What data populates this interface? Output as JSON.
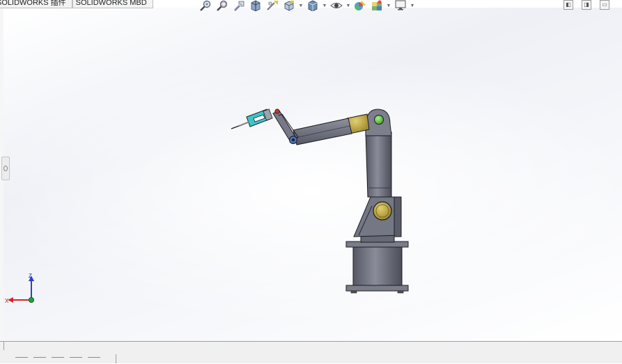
{
  "tabs": [
    {
      "label": "SOLIDWORKS 插件"
    },
    {
      "label": "SOLIDWORKS MBD"
    }
  ],
  "toolbar": {
    "icons": [
      "zoom-to-fit-icon",
      "zoom-to-area-icon",
      "previous-view-icon",
      "section-view-icon",
      "dynamic-annotation-icon",
      "view-orientation-icon",
      "display-style-icon",
      "hide-show-items-icon",
      "edit-appearance-icon",
      "apply-scene-icon",
      "view-settings-icon"
    ]
  },
  "triad": {
    "x_label": "X",
    "z_label": "Z"
  },
  "colors": {
    "arm_body": "#6c6f7c",
    "arm_edge": "#1c1c22",
    "joint_gold": "#cdb93c",
    "joint_green": "#5fcf3a",
    "tool_cyan": "#39c7c9",
    "base": "#6f727e"
  }
}
